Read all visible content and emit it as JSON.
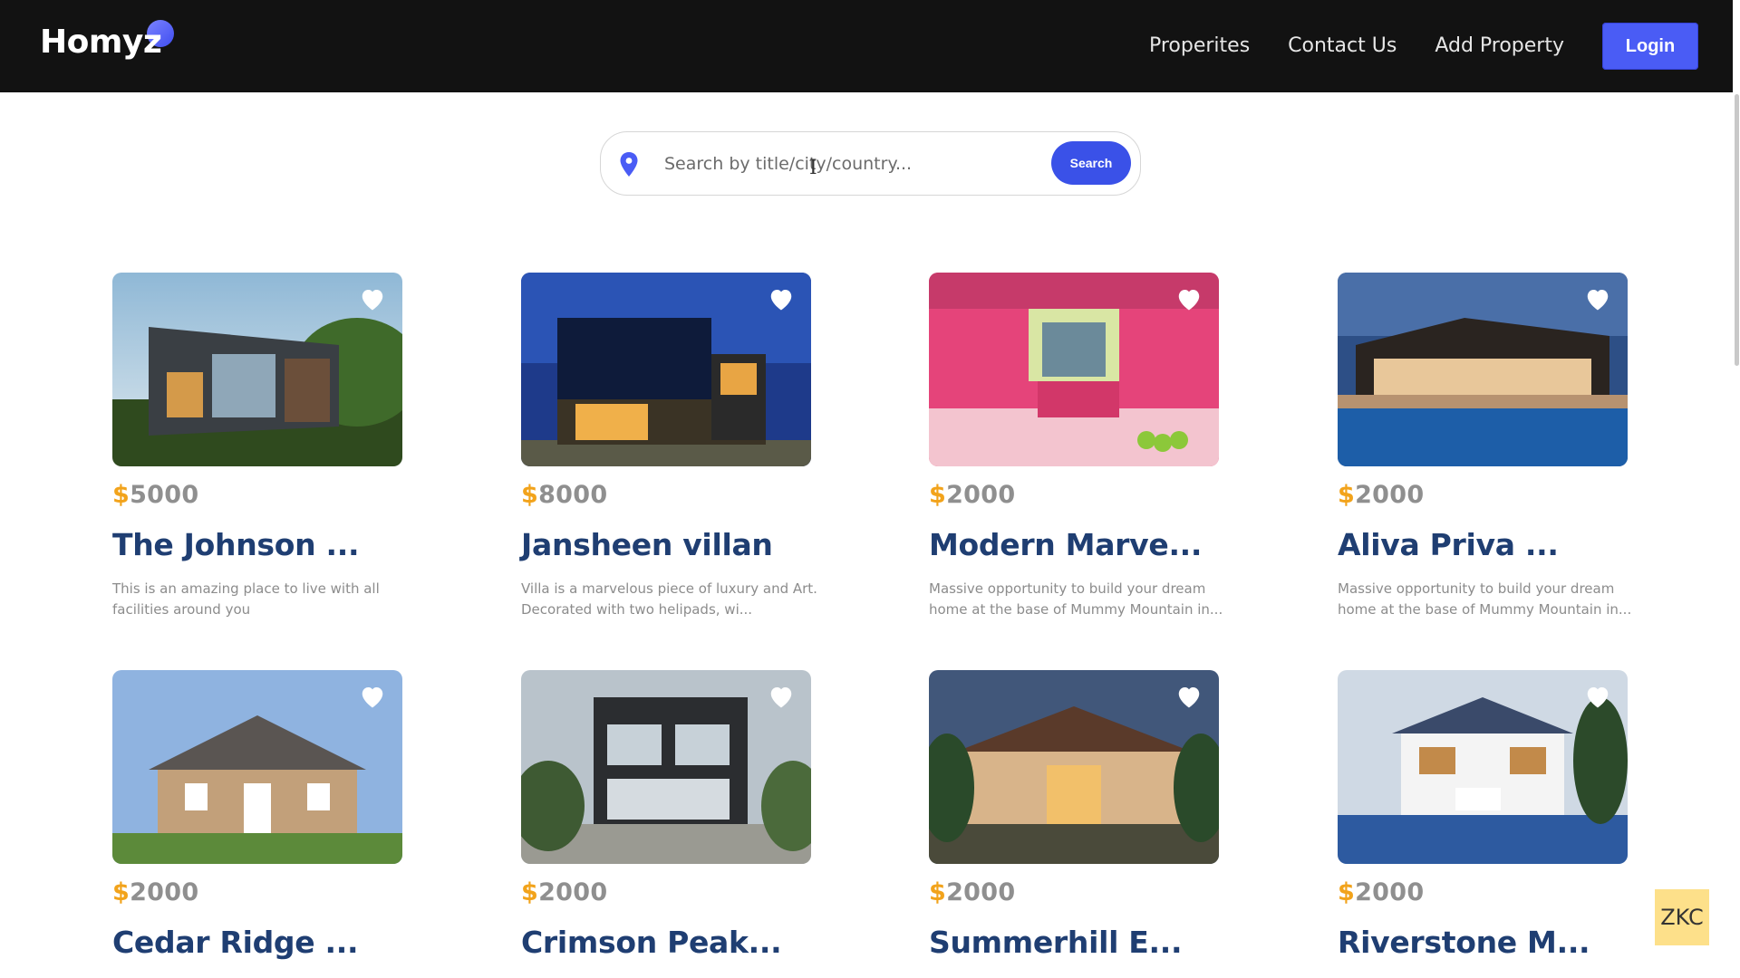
{
  "header": {
    "logo": "Homyz",
    "nav": [
      "Properites",
      "Contact Us",
      "Add Property"
    ],
    "login_label": "Login"
  },
  "search": {
    "placeholder": "Search by title/city/country...",
    "button_label": "Search"
  },
  "properties": [
    {
      "currency": "$",
      "price": "5000",
      "title": "The Johnson ...",
      "desc": "This is an amazing place to live with all facilities around you"
    },
    {
      "currency": "$",
      "price": "8000",
      "title": "Jansheen villan",
      "desc": "Villa is a marvelous piece of luxury and Art. Decorated with two helipads, wi..."
    },
    {
      "currency": "$",
      "price": "2000",
      "title": "Modern Marve...",
      "desc": "Massive opportunity to build your dream home at the base of Mummy Mountain in..."
    },
    {
      "currency": "$",
      "price": "2000",
      "title": "Aliva Priva ...",
      "desc": "Massive opportunity to build your dream home at the base of Mummy Mountain in..."
    },
    {
      "currency": "$",
      "price": "2000",
      "title": "Cedar Ridge ...",
      "desc": ""
    },
    {
      "currency": "$",
      "price": "2000",
      "title": "Crimson Peak...",
      "desc": ""
    },
    {
      "currency": "$",
      "price": "2000",
      "title": "Summerhill E...",
      "desc": ""
    },
    {
      "currency": "$",
      "price": "2000",
      "title": "Riverstone M...",
      "desc": ""
    }
  ],
  "watermark": "ZKC",
  "colors": {
    "header_bg": "#121212",
    "accent": "#4a5cf5",
    "title": "#1f3e72",
    "price_symbol": "#f2a31b"
  }
}
